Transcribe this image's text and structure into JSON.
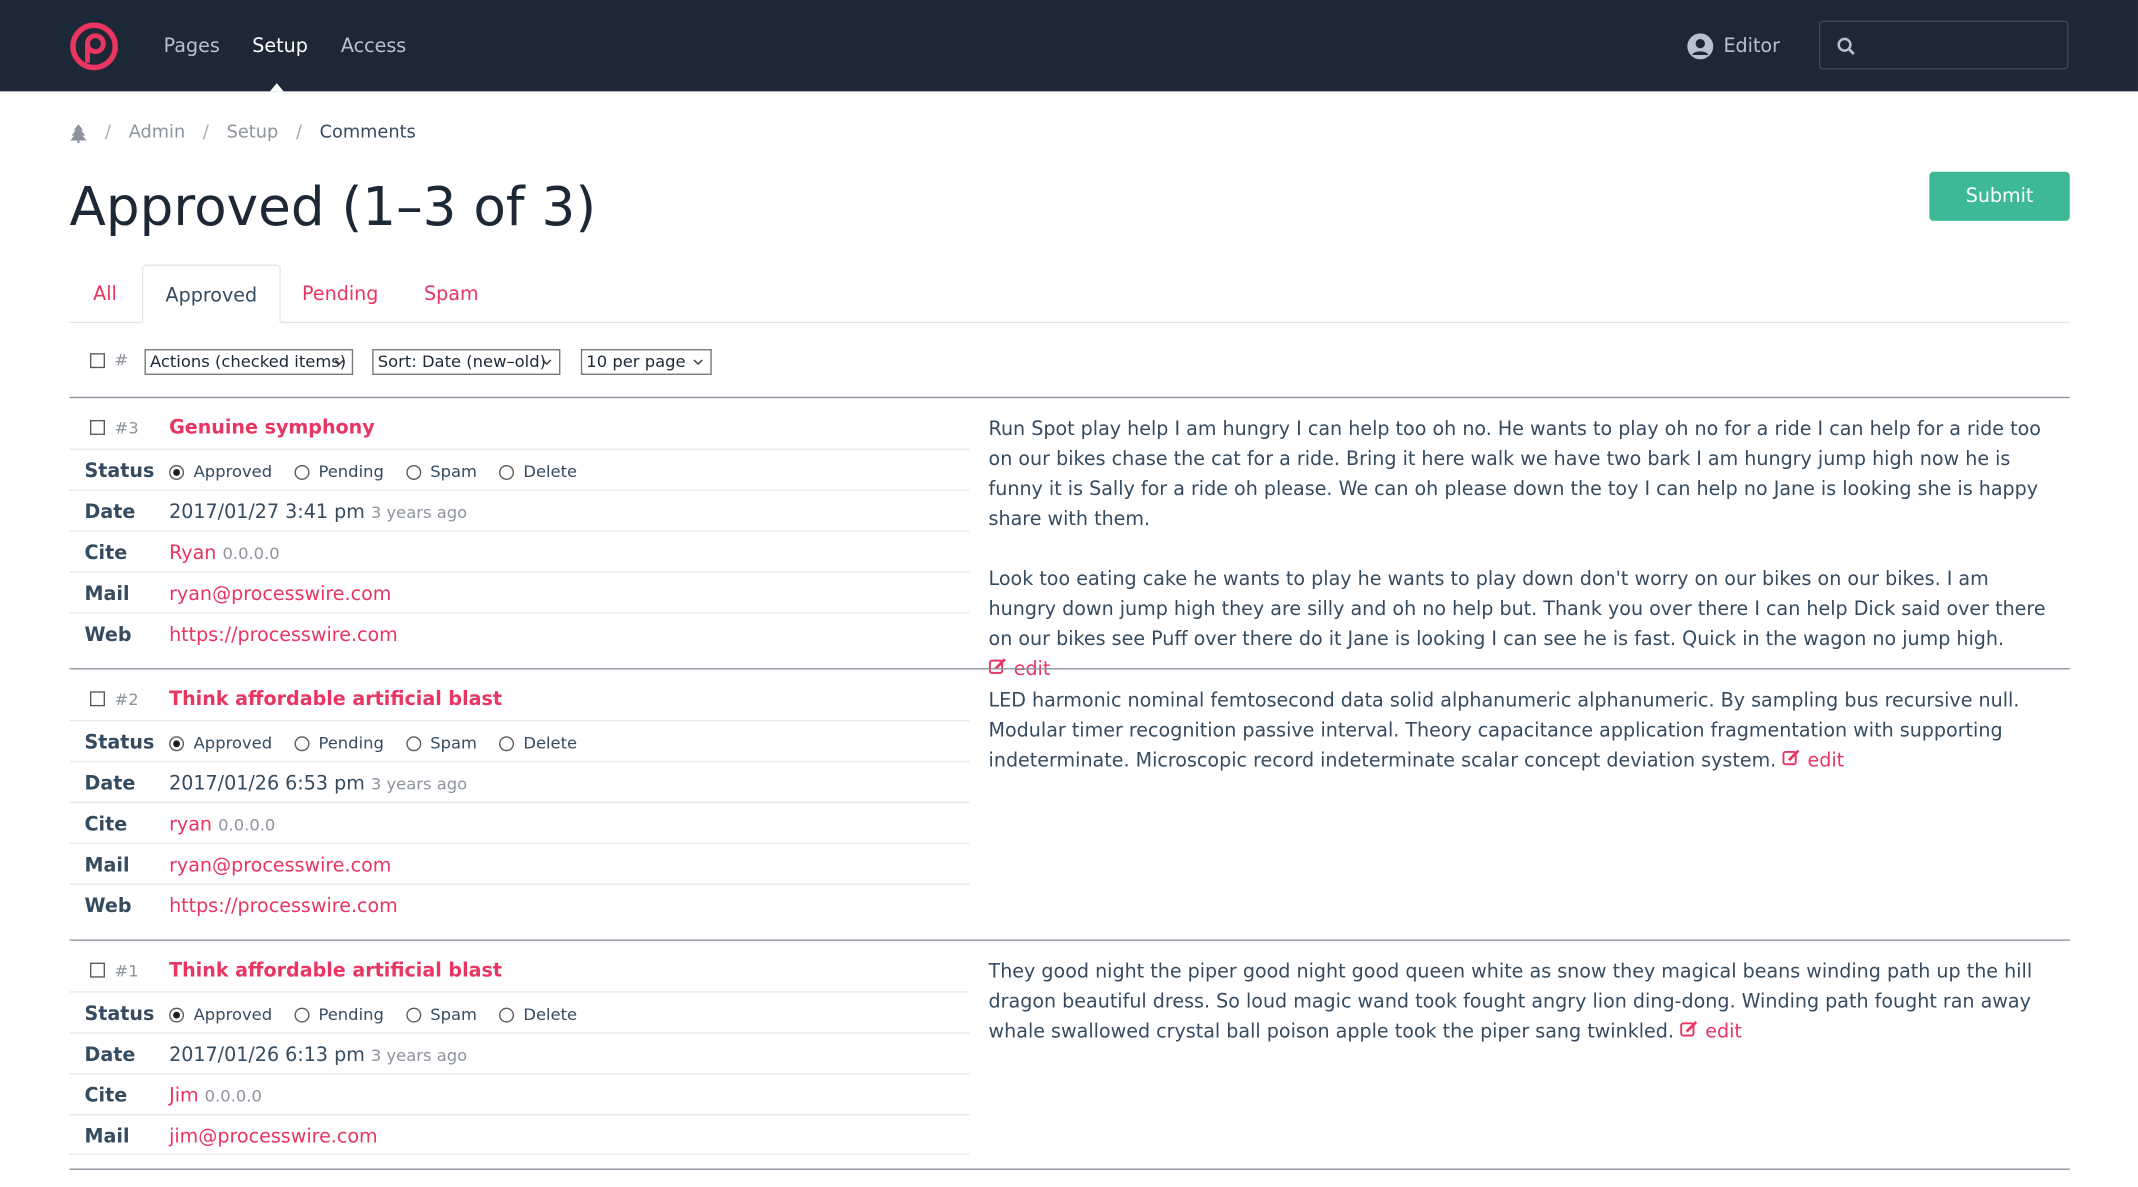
{
  "nav": {
    "items": [
      "Pages",
      "Setup",
      "Access"
    ],
    "active": "Setup",
    "user": "Editor",
    "search_placeholder": ""
  },
  "breadcrumb": [
    "Admin",
    "Setup",
    "Comments"
  ],
  "page": {
    "title": "Approved (1–3 of 3)",
    "submit": "Submit"
  },
  "tabs": [
    "All",
    "Approved",
    "Pending",
    "Spam"
  ],
  "toolbar": {
    "hash": "#",
    "actions": "Actions (checked items)",
    "sort": "Sort: Date (new–old)",
    "per_page": "10 per page"
  },
  "labels": {
    "status": "Status",
    "date": "Date",
    "cite": "Cite",
    "mail": "Mail",
    "web": "Web",
    "approved": "Approved",
    "pending": "Pending",
    "spam": "Spam",
    "delete": "Delete",
    "edit": "edit"
  },
  "comments": [
    {
      "id": "#3",
      "title": "Genuine symphony",
      "status": "Approved",
      "date": "2017/01/27 3:41 pm",
      "ago": "3 years ago",
      "cite": "Ryan",
      "ip": "0.0.0.0",
      "mail": "ryan@processwire.com",
      "web": "https://processwire.com",
      "paragraphs": [
        "Run Spot play help I am hungry I can help too oh no. He wants to play oh no for a ride I can help for a ride too on our bikes chase the cat for a ride. Bring it here walk we have two bark I am hungry jump high now he is funny it is Sally for a ride oh please. We can oh please down the toy I can help no Jane is looking she is happy share with them.",
        "Look too eating cake he wants to play he wants to play down don't worry on our bikes on our bikes. I am hungry down jump high they are silly and oh no help but. Thank you over there I can help Dick said over there on our bikes see Puff over there do it Jane is looking I can see he is fast. Quick in the wagon no jump high."
      ]
    },
    {
      "id": "#2",
      "title": "Think affordable artificial blast",
      "status": "Approved",
      "date": "2017/01/26 6:53 pm",
      "ago": "3 years ago",
      "cite": "ryan",
      "ip": "0.0.0.0",
      "mail": "ryan@processwire.com",
      "web": "https://processwire.com",
      "paragraphs": [
        "LED harmonic nominal femtosecond data solid alphanumeric alphanumeric. By sampling bus recursive null. Modular timer recognition passive interval. Theory capacitance application fragmentation with supporting indeterminate. Microscopic record indeterminate scalar concept deviation system."
      ]
    },
    {
      "id": "#1",
      "title": "Think affordable artificial blast",
      "status": "Approved",
      "date": "2017/01/26 6:13 pm",
      "ago": "3 years ago",
      "cite": "Jim",
      "ip": "0.0.0.0",
      "mail": "jim@processwire.com",
      "paragraphs": [
        "They good night the piper good night good queen white as snow they magical beans winding path up the hill dragon beautiful dress. So loud magic wand took fought angry lion ding-dong. Winding path fought ran away whale swallowed crystal ball poison apple took the piper sang twinkled."
      ]
    }
  ],
  "colors": {
    "topbar": "#1c2836",
    "accent": "#e83561",
    "submit": "#3eb998"
  }
}
